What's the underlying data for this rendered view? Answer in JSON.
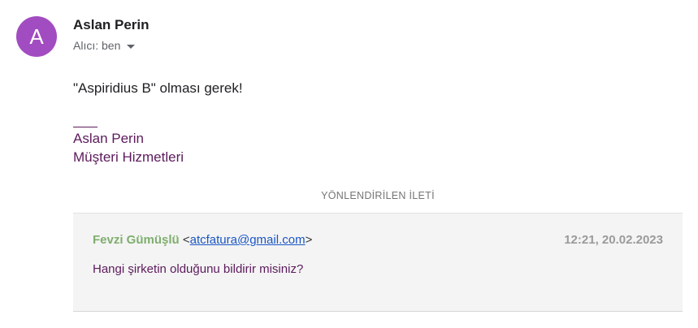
{
  "message": {
    "avatar_letter": "A",
    "sender_name": "Aslan Perin",
    "recipient_label": "Alıcı: ben",
    "body": "\"Aspiridius B\" olması gerek!",
    "signature": {
      "name": "Aslan Perin",
      "department": "Müşteri Hizmetleri"
    }
  },
  "forwarded": {
    "label": "YÖNLENDİRİLEN İLETİ",
    "sender_name": "Fevzi Gümüşlü",
    "email_open": "<",
    "email": "atcfatura@gmail.com",
    "email_close": ">",
    "datetime": "12:21, 20.02.2023",
    "body": "Hangi şirketin olduğunu bildirir misiniz?"
  },
  "colors": {
    "avatar_bg": "#a24cc1",
    "signature": "#5c1a5c",
    "forwarded_sender": "#7fae6e",
    "link": "#1a55c4",
    "forwarded_bg": "#f4f4f4"
  },
  "icons": {
    "recipient_dropdown": "chevron-down-icon"
  }
}
